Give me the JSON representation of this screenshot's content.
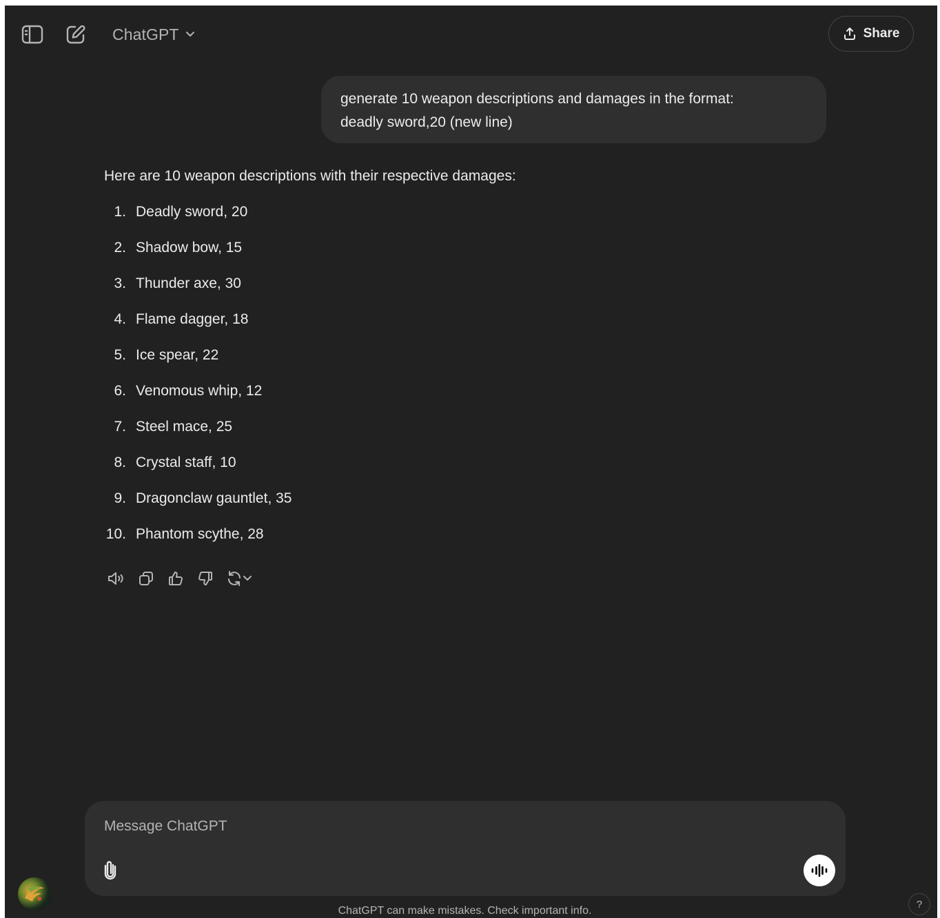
{
  "header": {
    "model_name": "ChatGPT",
    "share_label": "Share"
  },
  "conversation": {
    "user_message": {
      "line1": "generate 10 weapon descriptions and damages in the format:",
      "line2": "deadly sword,20 (new line)"
    },
    "assistant_message": {
      "intro": "Here are 10 weapon descriptions with their respective damages:",
      "items": [
        {
          "num": "1.",
          "text": "Deadly sword, 20"
        },
        {
          "num": "2.",
          "text": "Shadow bow, 15"
        },
        {
          "num": "3.",
          "text": "Thunder axe, 30"
        },
        {
          "num": "4.",
          "text": "Flame dagger, 18"
        },
        {
          "num": "5.",
          "text": "Ice spear, 22"
        },
        {
          "num": "6.",
          "text": "Venomous whip, 12"
        },
        {
          "num": "7.",
          "text": "Steel mace, 25"
        },
        {
          "num": "8.",
          "text": "Crystal staff, 10"
        },
        {
          "num": "9.",
          "text": "Dragonclaw gauntlet, 35"
        },
        {
          "num": "10.",
          "text": "Phantom scythe, 28"
        }
      ]
    },
    "actions": [
      "read-aloud-icon",
      "copy-icon",
      "thumbs-up-icon",
      "thumbs-down-icon",
      "regenerate-icon"
    ]
  },
  "composer": {
    "placeholder": "Message ChatGPT"
  },
  "footer": {
    "disclaimer": "ChatGPT can make mistakes. Check important info.",
    "help_label": "?"
  },
  "colors": {
    "background": "#212121",
    "bubble": "#2f2f2f",
    "text": "#ececec",
    "muted_text": "#b4b4b4",
    "voice_button": "#ffffff"
  }
}
